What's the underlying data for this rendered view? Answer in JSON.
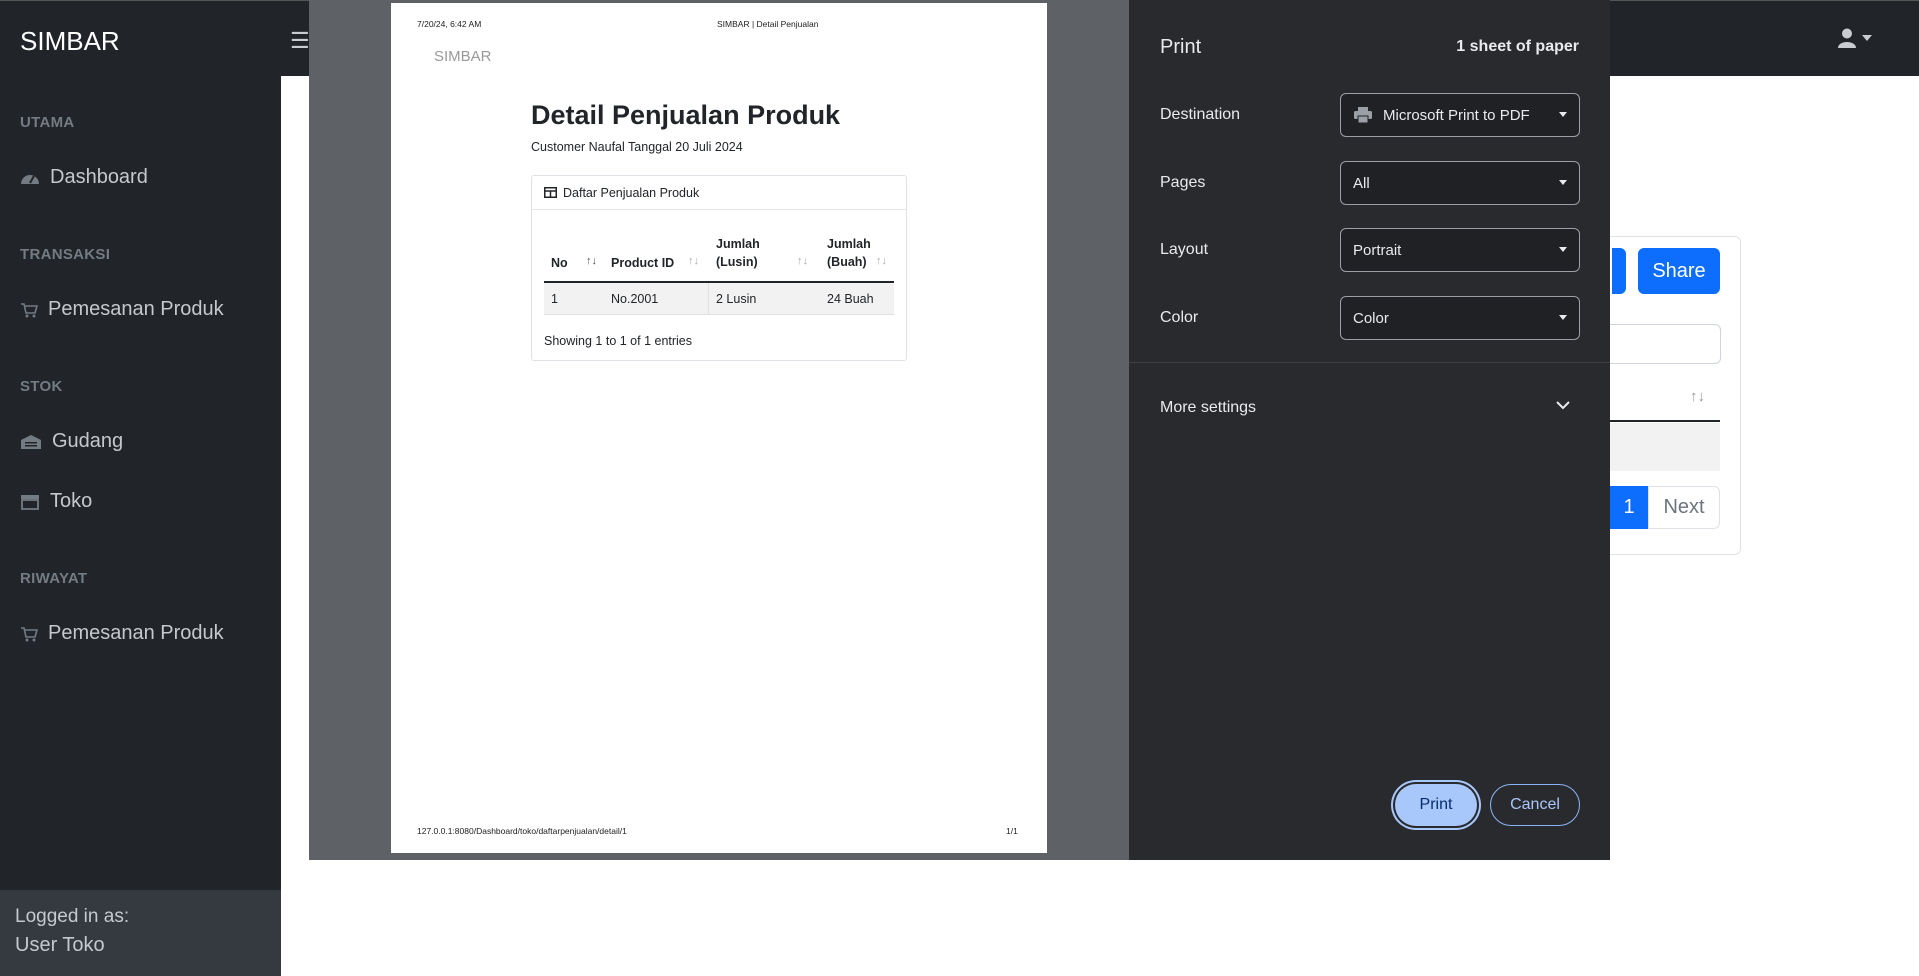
{
  "app": {
    "brand": "SIMBAR",
    "sidebar": {
      "sections": [
        {
          "title": "UTAMA",
          "items": [
            {
              "label": "Dashboard",
              "icon": "gauge-icon"
            }
          ]
        },
        {
          "title": "TRANSAKSI",
          "items": [
            {
              "label": "Pemesanan Produk",
              "icon": "cart-icon"
            }
          ]
        },
        {
          "title": "STOK",
          "items": [
            {
              "label": "Gudang",
              "icon": "warehouse-icon"
            },
            {
              "label": "Toko",
              "icon": "store-icon"
            }
          ]
        },
        {
          "title": "RIWAYAT",
          "items": [
            {
              "label": "Pemesanan Produk",
              "icon": "cart-icon"
            }
          ]
        }
      ],
      "footer": {
        "logged_in_label": "Logged in as:",
        "user": "User Toko"
      }
    },
    "background_page": {
      "share_button": "Share",
      "pagination": {
        "current": "1",
        "next": "Next"
      }
    }
  },
  "print_dialog": {
    "title": "Print",
    "sheets": "1 sheet of paper",
    "destination": {
      "label": "Destination",
      "value": "Microsoft Print to PDF"
    },
    "pages": {
      "label": "Pages",
      "value": "All"
    },
    "layout": {
      "label": "Layout",
      "value": "Portrait"
    },
    "color": {
      "label": "Color",
      "value": "Color"
    },
    "more_settings": "More settings",
    "print_button": "Print",
    "cancel_button": "Cancel"
  },
  "preview": {
    "header_datetime": "7/20/24, 6:42 AM",
    "header_title": "SIMBAR | Detail Penjualan",
    "logo": "SIMBAR",
    "title": "Detail Penjualan Produk",
    "subtitle": "Customer Naufal Tanggal 20 Juli 2024",
    "card_title": "Daftar Penjualan Produk",
    "columns": [
      "No",
      "Product ID",
      "Jumlah (Lusin)",
      "Jumlah (Buah)"
    ],
    "rows": [
      [
        "1",
        "No.2001",
        "2 Lusin",
        "24 Buah"
      ]
    ],
    "info": "Showing 1 to 1 of 1 entries",
    "footer_url": "127.0.0.1:8080/Dashboard/toko/daftarpenjualan/detail/1",
    "footer_page": "1/1"
  },
  "colors": {
    "sidebar": "#212529",
    "dialog": "#292a2d",
    "accent": "#0d6efd",
    "print_button": "#a8c7fa"
  }
}
